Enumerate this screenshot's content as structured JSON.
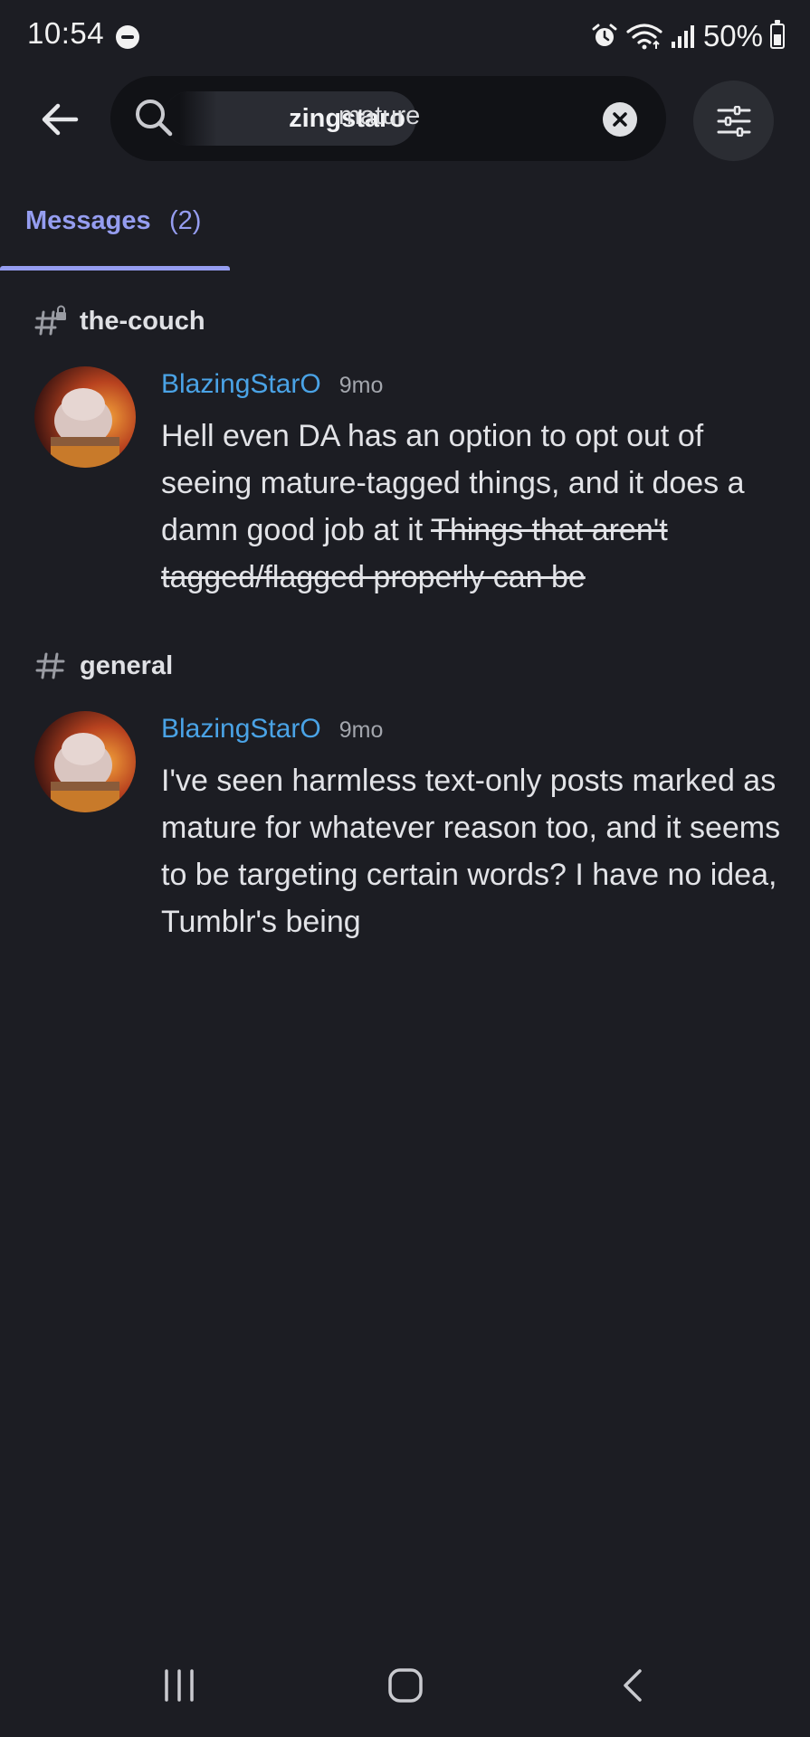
{
  "status_bar": {
    "time": "10:54",
    "battery": "50%"
  },
  "search": {
    "chip_text": "zingstaro",
    "query": "mature"
  },
  "tabs": [
    {
      "label": "Messages",
      "count": "(2)"
    }
  ],
  "results": [
    {
      "channel": "the-couch",
      "channel_locked": true,
      "author": "BlazingStarO",
      "timestamp": "9mo",
      "text": "Hell even DA has an option to opt out of seeing mature-tagged things, and it does a damn good job at it",
      "struck_text": "Things that aren't tagged/flagged properly can be"
    },
    {
      "channel": "general",
      "channel_locked": false,
      "author": "BlazingStarO",
      "timestamp": "9mo",
      "text": "I've seen harmless text-only posts marked as mature for whatever reason too, and it seems to be targeting certain words? I have no idea, Tumblr's being"
    }
  ],
  "colors": {
    "background": "#1c1d23",
    "accent": "#959df0",
    "username": "#4aa3e6"
  }
}
